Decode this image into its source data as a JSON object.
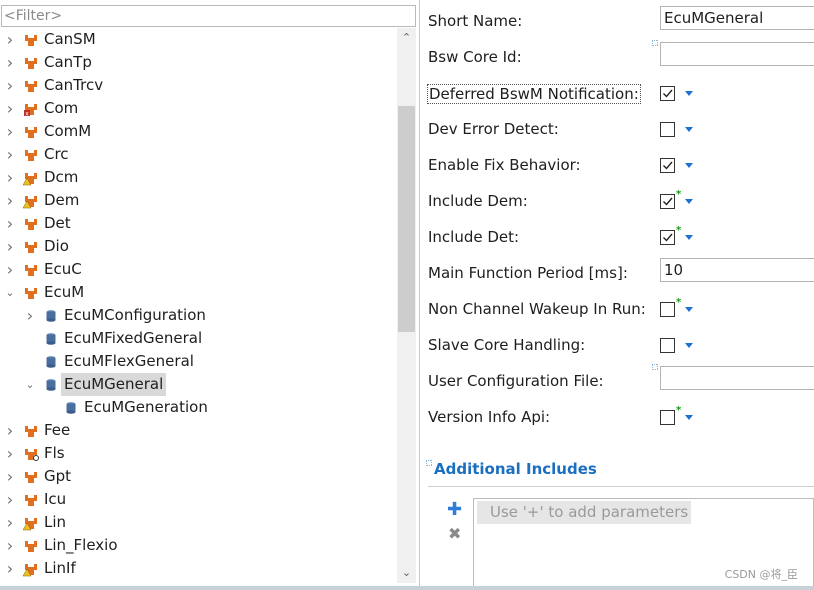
{
  "filter": {
    "placeholder": "<Filter>"
  },
  "tree": {
    "items": [
      {
        "label": "CanSM",
        "level": 0,
        "expander": "right",
        "icon": "module-icon"
      },
      {
        "label": "CanTp",
        "level": 0,
        "expander": "right",
        "icon": "module-icon"
      },
      {
        "label": "CanTrcv",
        "level": 0,
        "expander": "right",
        "icon": "module-icon"
      },
      {
        "label": "Com",
        "level": 0,
        "expander": "right",
        "icon": "module-error-icon"
      },
      {
        "label": "ComM",
        "level": 0,
        "expander": "right",
        "icon": "module-icon"
      },
      {
        "label": "Crc",
        "level": 0,
        "expander": "right",
        "icon": "module-icon"
      },
      {
        "label": "Dcm",
        "level": 0,
        "expander": "right",
        "icon": "module-warning-icon"
      },
      {
        "label": "Dem",
        "level": 0,
        "expander": "right",
        "icon": "module-warning-icon"
      },
      {
        "label": "Det",
        "level": 0,
        "expander": "right",
        "icon": "module-icon"
      },
      {
        "label": "Dio",
        "level": 0,
        "expander": "right",
        "icon": "module-icon"
      },
      {
        "label": "EcuC",
        "level": 0,
        "expander": "right",
        "icon": "module-icon"
      },
      {
        "label": "EcuM",
        "level": 0,
        "expander": "down",
        "icon": "module-icon"
      },
      {
        "label": "EcuMConfiguration",
        "level": 1,
        "expander": "right",
        "icon": "container-icon"
      },
      {
        "label": "EcuMFixedGeneral",
        "level": 1,
        "expander": "none",
        "icon": "container-icon"
      },
      {
        "label": "EcuMFlexGeneral",
        "level": 1,
        "expander": "none",
        "icon": "container-icon"
      },
      {
        "label": "EcuMGeneral",
        "level": 1,
        "expander": "down",
        "icon": "container-icon",
        "selected": true
      },
      {
        "label": "EcuMGeneration",
        "level": 2,
        "expander": "none",
        "icon": "container-icon"
      },
      {
        "label": "Fee",
        "level": 0,
        "expander": "right",
        "icon": "module-icon"
      },
      {
        "label": "Fls",
        "level": 0,
        "expander": "right",
        "icon": "module-link-icon"
      },
      {
        "label": "Gpt",
        "level": 0,
        "expander": "right",
        "icon": "module-icon"
      },
      {
        "label": "Icu",
        "level": 0,
        "expander": "right",
        "icon": "module-icon"
      },
      {
        "label": "Lin",
        "level": 0,
        "expander": "right",
        "icon": "module-warning-icon"
      },
      {
        "label": "Lin_Flexio",
        "level": 0,
        "expander": "right",
        "icon": "module-icon"
      },
      {
        "label": "LinIf",
        "level": 0,
        "expander": "right",
        "icon": "module-warning-icon"
      }
    ]
  },
  "form": {
    "fields": [
      {
        "label": "Short Name:",
        "type": "text",
        "value": "EcuMGeneral"
      },
      {
        "label": "Bsw Core Id:",
        "type": "text",
        "value": "",
        "marker": true
      },
      {
        "label": "Deferred BswM Notification:",
        "type": "checkbox",
        "checked": true,
        "focused": true
      },
      {
        "label": "Dev Error Detect:",
        "type": "checkbox",
        "checked": false
      },
      {
        "label": "Enable Fix Behavior:",
        "type": "checkbox",
        "checked": true
      },
      {
        "label": "Include Dem:",
        "type": "checkbox",
        "checked": true,
        "star": true
      },
      {
        "label": "Include Det:",
        "type": "checkbox",
        "checked": true,
        "star": true
      },
      {
        "label": "Main Function Period [ms]:",
        "type": "text",
        "value": "10"
      },
      {
        "label": "Non Channel Wakeup In Run:",
        "type": "checkbox",
        "checked": false,
        "star": true
      },
      {
        "label": "Slave Core Handling:",
        "type": "checkbox",
        "checked": false
      },
      {
        "label": "User Configuration File:",
        "type": "text",
        "value": "",
        "marker": true
      },
      {
        "label": "Version Info Api:",
        "type": "checkbox",
        "checked": false,
        "star": true
      }
    ]
  },
  "section": {
    "title": "Additional Includes",
    "hint": "Use '+' to add parameters"
  },
  "watermark": "CSDN @将_臣",
  "colors": {
    "accent": "#1a6fc0",
    "star": "#1a9a1a",
    "module_icon": "#e07020"
  }
}
